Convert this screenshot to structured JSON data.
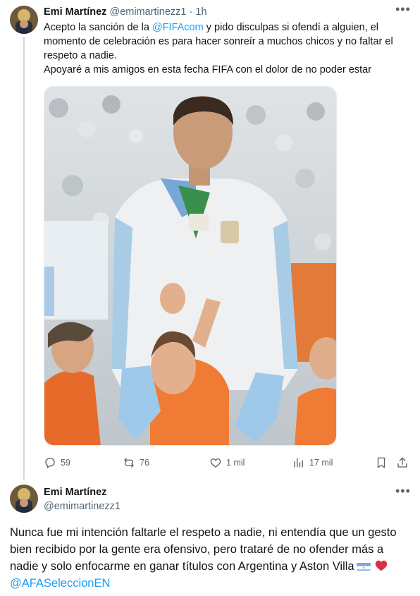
{
  "tweet1": {
    "author_name": "Emi Martínez",
    "handle": "@emimartinezz1",
    "separator": "·",
    "time": "1h",
    "text_before_mention": "Acepto la sanción de la ",
    "mention": "@FIFAcom",
    "text_after_mention": " y pido disculpas si ofendí a alguien, el momento de celebración es para hacer sonreír a muchos chicos y no faltar el respeto a nadie.",
    "text_line2": "Apoyaré a mis amigos en esta fecha FIFA con el dolor de no poder estar",
    "replies": "59",
    "retweets": "76",
    "likes": "1 mil",
    "views": "17 mil"
  },
  "tweet2": {
    "author_name": "Emi Martínez",
    "handle": "@emimartinezz1",
    "text": "Nunca fue mi intención faltarle el respeto a nadie, ni entendía que un gesto bien recibido por la gente era ofensivo, pero trataré de no ofender más a nadie y solo enfocarme en ganar títulos con Argentina y Aston Villa",
    "mention": "@AFASeleccionEN",
    "emojis": [
      "argentina-flag",
      "red-heart"
    ]
  },
  "colors": {
    "text": "#0f1419",
    "secondary": "#536471",
    "accent": "#1d9bf0",
    "thread_line": "#cfd9de"
  },
  "icons": [
    "reply-icon",
    "retweet-icon",
    "like-icon",
    "views-icon",
    "bookmark-icon",
    "share-icon",
    "more-icon"
  ]
}
